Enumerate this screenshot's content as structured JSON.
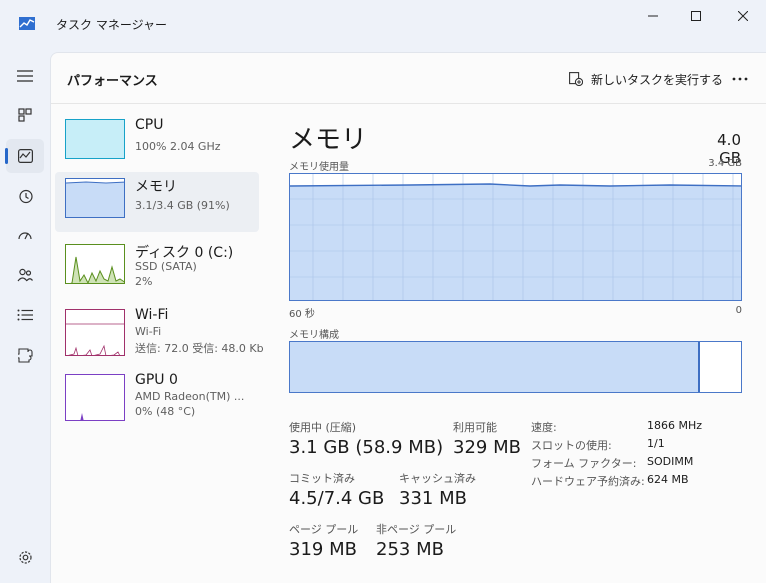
{
  "window": {
    "title": "タスク マネージャー"
  },
  "header": {
    "title": "パフォーマンス",
    "new_task_label": "新しいタスクを実行する"
  },
  "rail": {
    "items": [
      {
        "icon": "hamburger-menu-icon"
      },
      {
        "icon": "processes-icon"
      },
      {
        "icon": "performance-icon",
        "active": true
      },
      {
        "icon": "app-history-icon"
      },
      {
        "icon": "startup-apps-icon"
      },
      {
        "icon": "users-icon"
      },
      {
        "icon": "details-icon"
      },
      {
        "icon": "services-icon"
      },
      {
        "icon": "settings-icon"
      }
    ]
  },
  "resources": [
    {
      "name": "CPU",
      "sub1": "100%  2.04 GHz",
      "sub2": "",
      "color": "#17a2c8"
    },
    {
      "name": "メモリ",
      "sub1": "3.1/3.4 GB (91%)",
      "sub2": "",
      "color": "#3e6fc3",
      "selected": true
    },
    {
      "name": "ディスク 0 (C:)",
      "sub1": "SSD (SATA)",
      "sub2": "2%",
      "color": "#5a8f1e"
    },
    {
      "name": "Wi-Fi",
      "sub1": "Wi-Fi",
      "sub2": "送信: 72.0  受信: 48.0 Kb",
      "color": "#a0306a"
    },
    {
      "name": "GPU 0",
      "sub1": "AMD Radeon(TM) ...",
      "sub2": "0%  (48 °C)",
      "color": "#7b3fc4"
    }
  ],
  "detail": {
    "title": "メモリ",
    "total": "4.0 GB",
    "usage_label": "メモリ使用量",
    "usage_max": "3.4 GB",
    "time_left": "60 秒",
    "time_right": "0",
    "composition_label": "メモリ構成",
    "composition_used_fraction": 0.91,
    "stats": {
      "in_use_label": "使用中 (圧縮)",
      "in_use_value": "3.1 GB (58.9 MB)",
      "available_label": "利用可能",
      "available_value": "329 MB",
      "committed_label": "コミット済み",
      "committed_value": "4.5/7.4 GB",
      "cached_label": "キャッシュ済み",
      "cached_value": "331 MB",
      "paged_label": "ページ プール",
      "paged_value": "319 MB",
      "nonpaged_label": "非ページ プール",
      "nonpaged_value": "253 MB"
    },
    "kv": [
      {
        "label": "速度:",
        "value": "1866 MHz"
      },
      {
        "label": "スロットの使用:",
        "value": "1/1"
      },
      {
        "label": "フォーム ファクター:",
        "value": "SODIMM"
      },
      {
        "label": "ハードウェア予約済み:",
        "value": "624 MB"
      }
    ]
  }
}
